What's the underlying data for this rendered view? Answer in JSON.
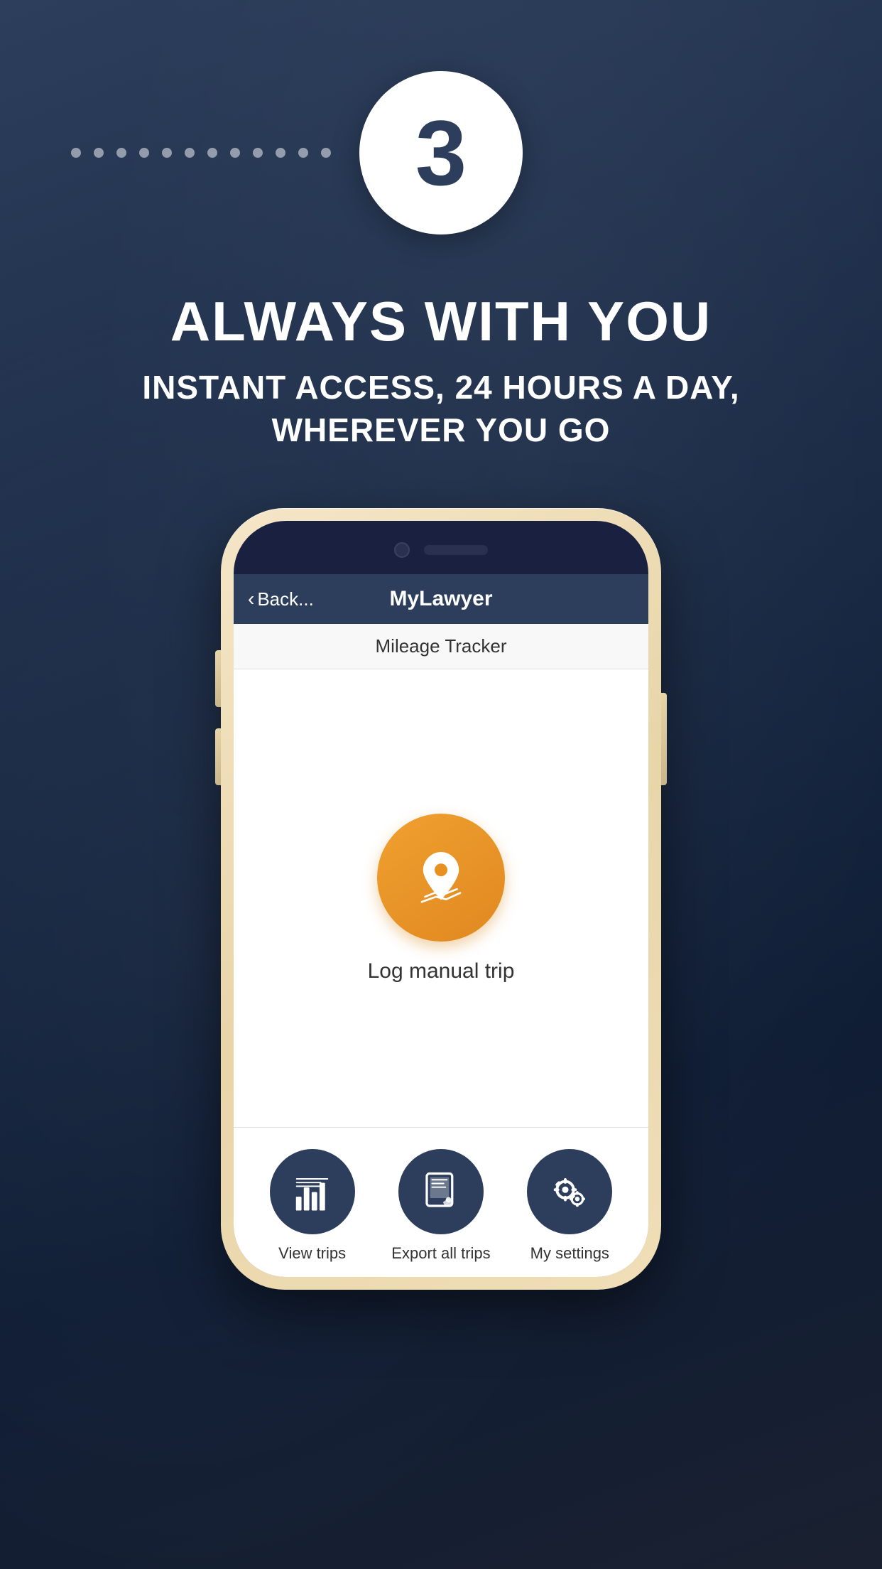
{
  "step": {
    "number": "3",
    "dots_count": 12
  },
  "headline": {
    "main": "ALWAYS WITH YOU",
    "sub": "INSTANT ACCESS, 24 HOURS A DAY, WHEREVER YOU GO"
  },
  "phone": {
    "nav": {
      "back_label": "Back...",
      "title": "MyLawyer"
    },
    "sub_header": "Mileage Tracker",
    "main_action": {
      "label": "Log manual trip"
    },
    "grid_items": [
      {
        "label": "View trips",
        "icon": "list-chart-icon"
      },
      {
        "label": "Export all trips",
        "icon": "tablet-export-icon"
      },
      {
        "label": "My settings",
        "icon": "gear-icon"
      }
    ]
  },
  "colors": {
    "background_dark": "#1a2a45",
    "step_circle_bg": "#ffffff",
    "step_number_color": "#2c3e5c",
    "nav_bg": "#2c3e5c",
    "action_icon_bg": "#e89020",
    "grid_icon_bg": "#2c3e5c"
  }
}
